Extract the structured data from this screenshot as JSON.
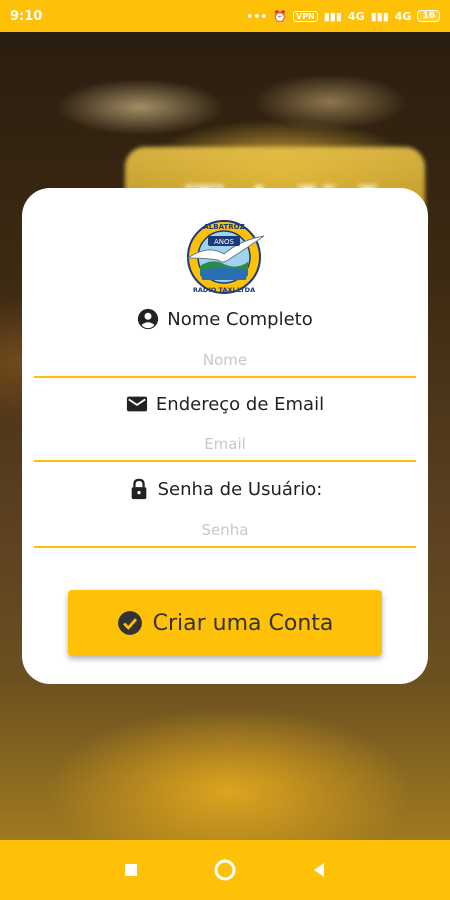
{
  "status_bar": {
    "time": "9:10",
    "network_1": "4G",
    "network_2": "4G",
    "vpn": "VPN",
    "battery": "16"
  },
  "background": {
    "sign_text": "TAXI"
  },
  "logo": {
    "top_text": "ALBATROZ",
    "bottom_text": "RADIO TAXI LTDA",
    "badge_text": "ANOS"
  },
  "form": {
    "name": {
      "label": "Nome Completo",
      "placeholder": "Nome",
      "icon": "account-circle-icon"
    },
    "email": {
      "label": "Endereço de Email",
      "placeholder": "Email",
      "icon": "mail-icon"
    },
    "password": {
      "label": "Senha de Usuário:",
      "placeholder": "Senha",
      "icon": "lock-icon"
    },
    "submit_label": "Criar uma Conta"
  },
  "colors": {
    "accent": "#FFC107",
    "card": "#FFFFFF",
    "text": "#222222"
  }
}
